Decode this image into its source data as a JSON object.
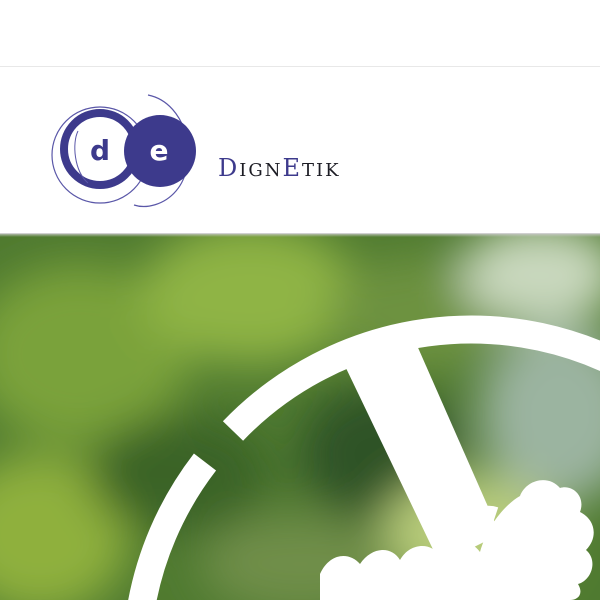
{
  "brand": {
    "logo_letters": [
      "d",
      "e"
    ],
    "wordmark_parts": [
      {
        "text": "D",
        "style": "cap"
      },
      {
        "text": "IGN",
        "style": "small"
      },
      {
        "text": "E",
        "style": "cap"
      },
      {
        "text": "TIK",
        "style": "small"
      }
    ],
    "colors": {
      "logo_blue": "#3d3a8c",
      "logo_outline": "#5a57a8",
      "wordmark_accent": "#3d3a8c",
      "wordmark_text": "#1c1c24"
    }
  },
  "hero": {
    "background_colors": {
      "base": "#4f7a30",
      "light_green": "#9cbc4a",
      "dark_green": "#2e5226",
      "highlight": "#e0ecd2"
    },
    "graphic_icon": "bicycle-wheel-icon",
    "graphic_color": "#ffffff"
  }
}
